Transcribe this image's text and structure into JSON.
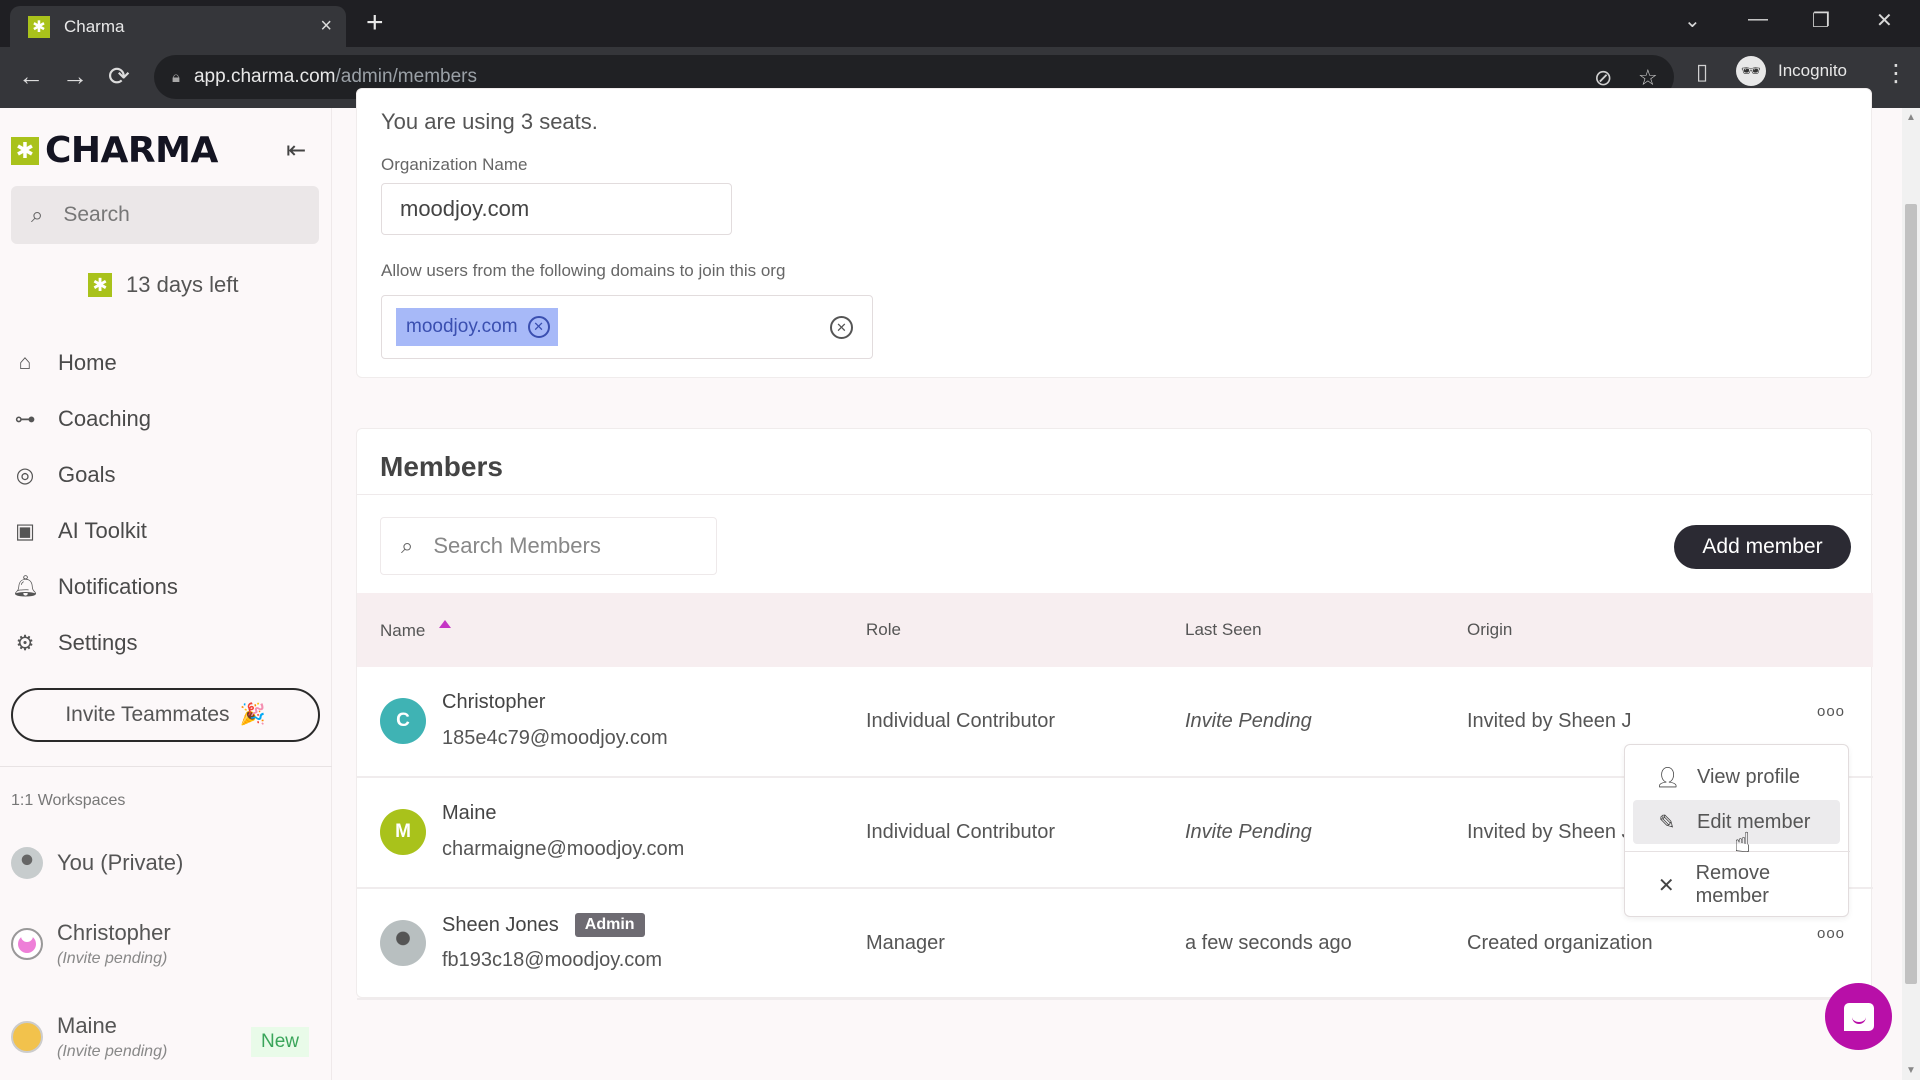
{
  "browser": {
    "tab_title": "Charma",
    "tab_close": "×",
    "new_tab": "+",
    "url_host": "app.charma.com",
    "url_path": "/admin/members",
    "profile_label": "Incognito",
    "icons": {
      "back": "←",
      "forward": "→",
      "reload": "⟳",
      "lock": "🔒",
      "eye_off": "⊘",
      "star": "☆",
      "sidepanel": "▯",
      "menu": "⋮",
      "tab_search": "⌄",
      "minimize": "—",
      "restore": "❐",
      "close": "✕"
    }
  },
  "sidebar": {
    "logo_text": "CHARMA",
    "collapse_icon": "⇤",
    "search_placeholder": "Search",
    "trial_text": "13 days left",
    "nav": [
      {
        "label": "Home",
        "icon": "⌂"
      },
      {
        "label": "Coaching",
        "icon": "⊶"
      },
      {
        "label": "Goals",
        "icon": "◎"
      },
      {
        "label": "AI Toolkit",
        "icon": "▣"
      },
      {
        "label": "Notifications",
        "icon": "🔔︎"
      },
      {
        "label": "Settings",
        "icon": "⚙"
      }
    ],
    "invite_label": "Invite Teammates",
    "invite_emoji": "🎉",
    "workspaces_title": "1:1 Workspaces",
    "workspaces": [
      {
        "name": "You (Private)",
        "sub": "",
        "avatar_color": "#9da5a6"
      },
      {
        "name": "Christopher",
        "sub": "(Invite pending)",
        "avatar_color": "#ee7fd8"
      },
      {
        "name": "Maine",
        "sub": "(Invite pending)",
        "avatar_color": "#f2c24c",
        "badge": "New"
      }
    ]
  },
  "org": {
    "seats_text": "You are using 3 seats.",
    "name_label": "Organization Name",
    "name_value": "moodjoy.com",
    "domains_label": "Allow users from the following domains to join this org",
    "domains": [
      "moodjoy.com"
    ],
    "chip_remove": "✕",
    "clear_all": "✕"
  },
  "members": {
    "title": "Members",
    "search_placeholder": "Search Members",
    "add_button": "Add member",
    "columns": {
      "name": "Name",
      "role": "Role",
      "last_seen": "Last Seen",
      "origin": "Origin"
    },
    "sort": {
      "column": "Name",
      "direction": "ascending"
    },
    "rows": [
      {
        "initial": "C",
        "avatar_color": "#3fb3b4",
        "name": "Christopher",
        "email": "185e4c79@moodjoy.com",
        "badge": "",
        "role": "Individual Contributor",
        "last_seen": "Invite Pending",
        "origin": "Invited by Sheen J"
      },
      {
        "initial": "M",
        "avatar_color": "#a9c21b",
        "name": "Maine",
        "email": "charmaigne@moodjoy.com",
        "badge": "",
        "role": "Individual Contributor",
        "last_seen": "Invite Pending",
        "origin": "Invited by Sheen J"
      },
      {
        "initial": "",
        "avatar_color": "#9da5a6",
        "name": "Sheen Jones",
        "email": "fb193c18@moodjoy.com",
        "badge": "Admin",
        "role": "Manager",
        "last_seen": "a few seconds ago",
        "origin": "Created organization"
      }
    ],
    "more_icon": "ooo",
    "context_menu": {
      "items": [
        {
          "label": "View profile",
          "icon": "👤︎"
        },
        {
          "label": "Edit member",
          "icon": "✎",
          "hovered": true
        },
        {
          "label": "Remove member",
          "icon": "✕"
        }
      ]
    }
  },
  "chat_widget": {
    "label": "Open chat"
  },
  "colors": {
    "brand_green": "#a9c21b",
    "accent_magenta": "#b80fa8",
    "chip_blue": "#a7b9f8",
    "button_dark": "#2b2a33"
  }
}
